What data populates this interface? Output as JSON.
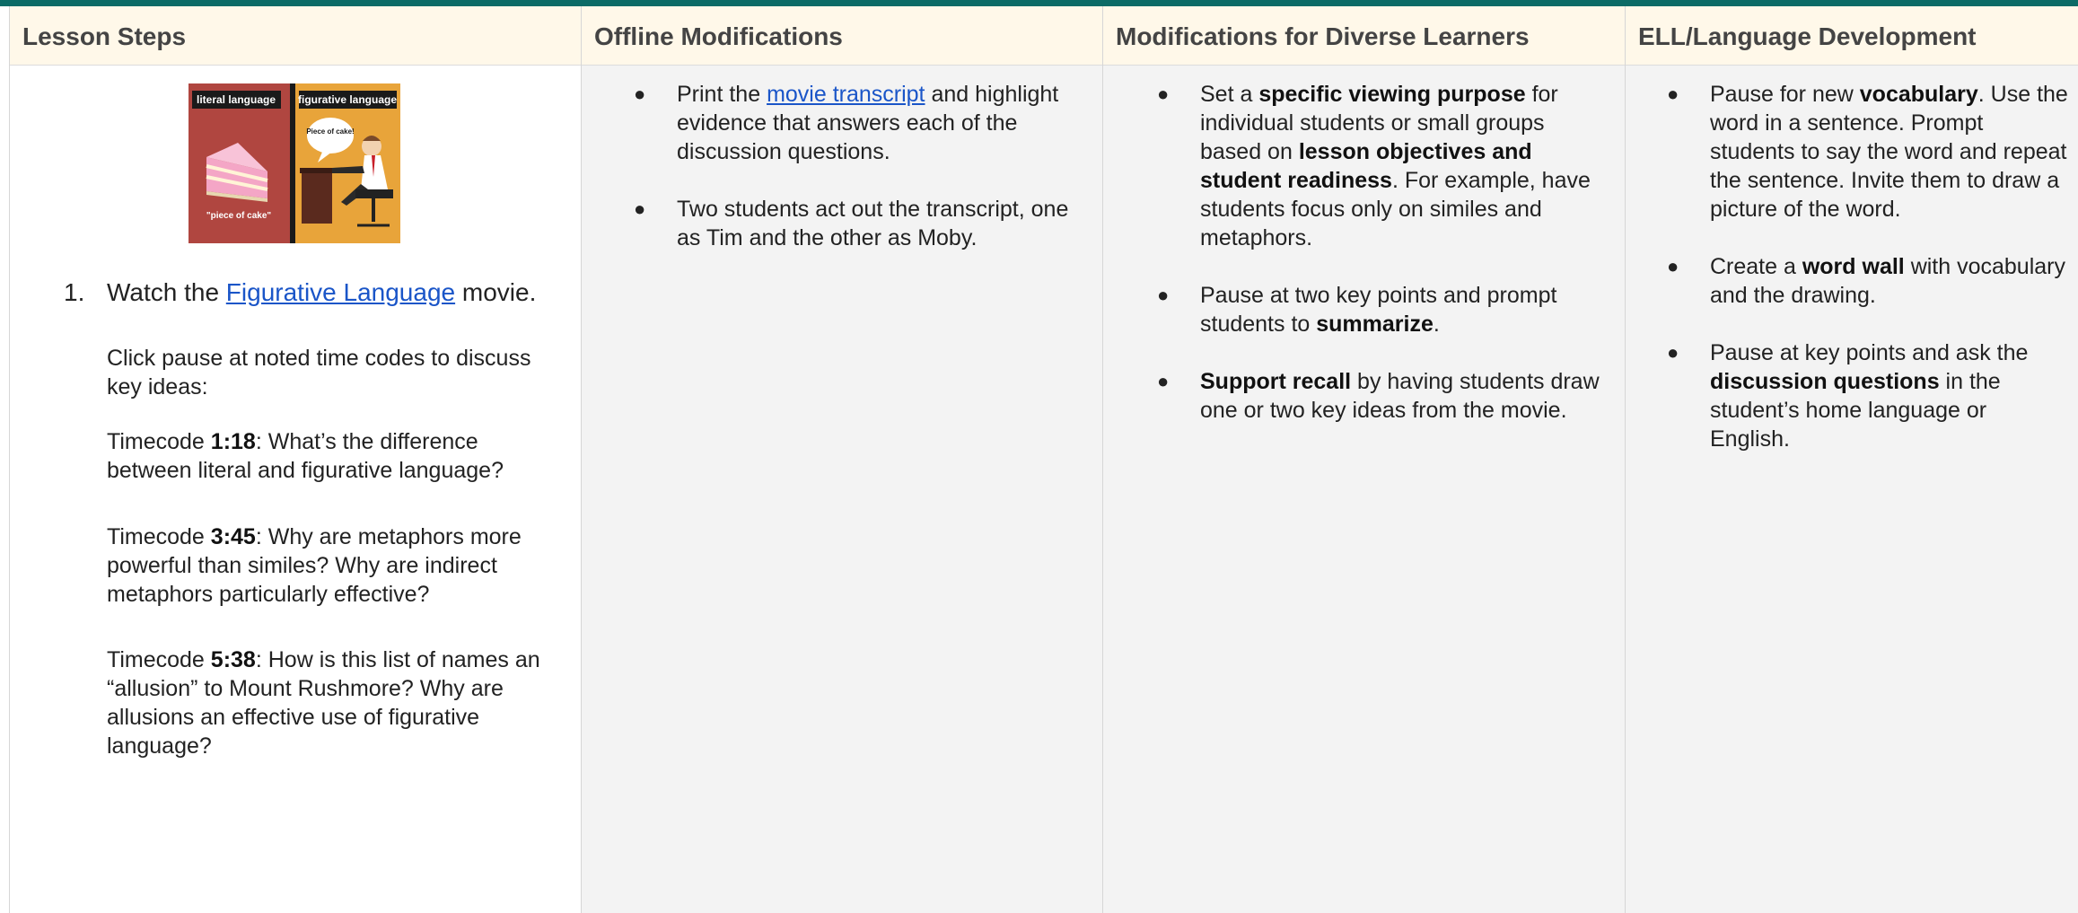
{
  "headers": [
    "Lesson Steps",
    "Offline Modifications",
    "Modifications for Diverse Learners",
    "ELL/Language Development"
  ],
  "illustration": {
    "left_label": "literal language",
    "right_label": "figurative language",
    "caption": "\"piece of cake\"",
    "bubble": "Piece of cake!"
  },
  "lesson_steps": {
    "step_number": "1.",
    "step_prefix": "Watch the ",
    "step_link": "Figurative Language",
    "step_suffix": " movie.",
    "intro": "Click pause at noted time codes to discuss key ideas:",
    "timecodes": [
      {
        "prefix": "Timecode ",
        "code": "1:18",
        "text": ": What’s the difference between literal and figurative language?"
      },
      {
        "prefix": "Timecode ",
        "code": "3:45",
        "text": ": Why are metaphors more powerful than similes? Why are indirect metaphors particularly effective?"
      },
      {
        "prefix": "Timecode ",
        "code": "5:38",
        "text": ": How is this list of names an “allusion” to Mount Rushmore? Why are allusions an effective use of figurative language?"
      }
    ]
  },
  "offline": {
    "item1_prefix": "Print the ",
    "item1_link": "movie transcript",
    "item1_suffix": " and highlight evidence that answers each of the discussion questions.",
    "item2": "Two students act out the transcript, one as Tim and the other as Moby."
  },
  "diverse": {
    "i1_a": "Set a ",
    "i1_b": "specific viewing purpose",
    "i1_c": " for individual students or small groups based on ",
    "i1_d": "lesson objectives and student readiness",
    "i1_e": ". For example, have students focus only on similes and metaphors.",
    "i2_a": "Pause at two key points and prompt students to ",
    "i2_b": "summarize",
    "i2_c": ".",
    "i3_a": "Support recall",
    "i3_b": " by having students draw one or two key ideas from the movie."
  },
  "ell": {
    "i1_a": "Pause for new ",
    "i1_b": "vocabulary",
    "i1_c": ". Use the word in a sentence. Prompt students to say the word and repeat the sentence. Invite them to draw a picture of the word.",
    "i2_a": "Create a ",
    "i2_b": "word wall",
    "i2_c": " with vocabulary and the drawing.",
    "i3_a": "Pause at key points and ask the ",
    "i3_b": "discussion questions",
    "i3_c": " in the student’s home language or English."
  },
  "bullet": "●",
  "colors": {
    "topbar": "#0b6b66",
    "header_bg": "#fff8e9",
    "link": "#1a55c8",
    "left_panel": "#b04640",
    "right_panel": "#e8a43a"
  }
}
